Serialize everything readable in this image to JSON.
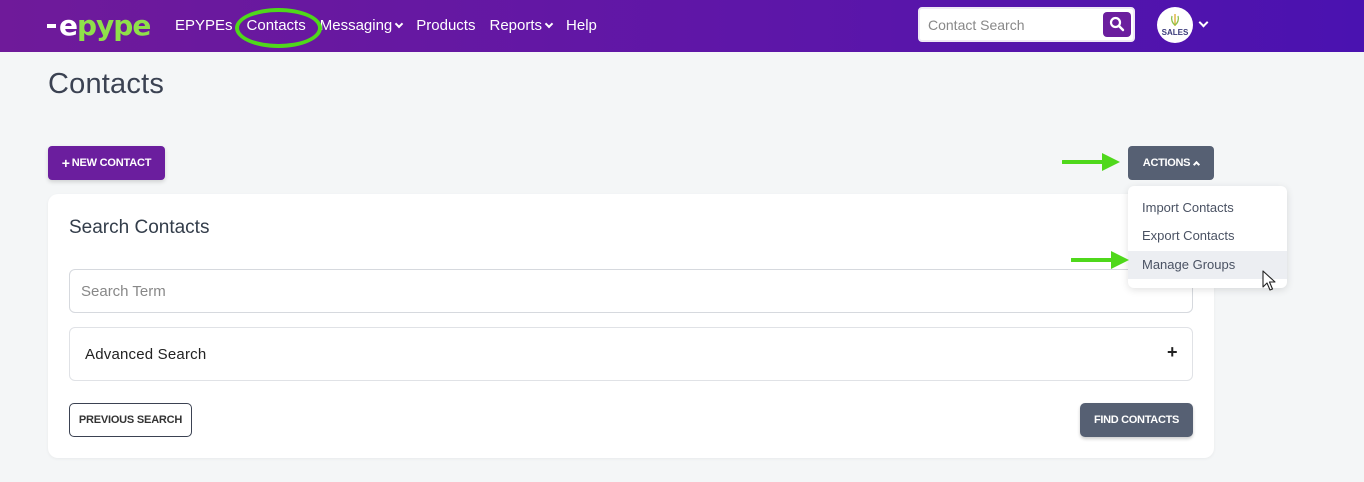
{
  "app": {
    "logo_dash": "-",
    "logo_e": "e",
    "logo_rest": "pype"
  },
  "nav": {
    "items": [
      {
        "label": "EPYPEs",
        "dropdown": false
      },
      {
        "label": "Contacts",
        "dropdown": false,
        "active": true
      },
      {
        "label": "Messaging",
        "dropdown": true
      },
      {
        "label": "Products",
        "dropdown": false
      },
      {
        "label": "Reports",
        "dropdown": true
      },
      {
        "label": "Help",
        "dropdown": false
      }
    ]
  },
  "header_search": {
    "placeholder": "Contact Search",
    "icon": "search-icon"
  },
  "avatar": {
    "label": "SALES"
  },
  "page": {
    "title": "Contacts"
  },
  "toolbar": {
    "new_contact_label": "NEW CONTACT",
    "actions_label": "ACTIONS"
  },
  "actions_menu": {
    "items": [
      "Import Contacts",
      "Export Contacts",
      "Manage Groups"
    ],
    "hovered": "Manage Groups"
  },
  "search_card": {
    "title": "Search Contacts",
    "term_placeholder": "Search Term",
    "advanced_label": "Advanced Search",
    "advanced_toggle": "+",
    "previous_label": "PREVIOUS SEARCH",
    "find_label": "FIND CONTACTS"
  },
  "colors": {
    "brand_purple": "#6b1e9e",
    "accent_green": "#8fe04a",
    "annotation_green": "#4fd81b",
    "slate_button": "#566073"
  }
}
